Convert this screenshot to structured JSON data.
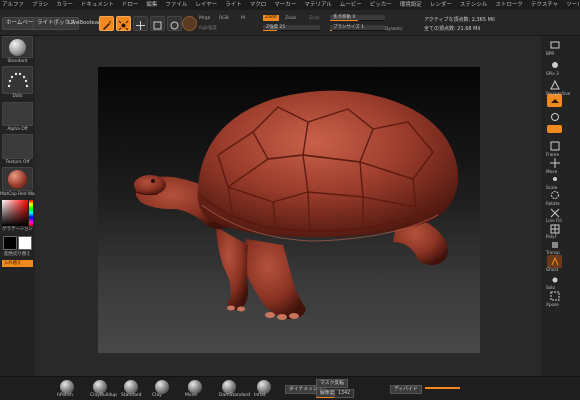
{
  "menu": [
    "アルファ",
    "ブラシ",
    "カラー",
    "ドキュメント",
    "ドロー",
    "編集",
    "ファイル",
    "レイヤー",
    "ライト",
    "マクロ",
    "マーカー",
    "マテリアル",
    "ムービー",
    "ピッカー",
    "環境設定",
    "レンダー",
    "ステンシル",
    "ストローク",
    "テクスチャ",
    "ツール",
    "トランスフォーム",
    "Zプラグイン",
    "Zスクリプト"
  ],
  "toolbar": {
    "home_page": "ホームページ",
    "lightbox": "ライトボックス",
    "live_boolean": "LiveBoolean",
    "mrgb": "Mrgb",
    "rgb": "RGB",
    "m": "M",
    "rgb_intensity": "Rgb強度",
    "zadd": "Zadd",
    "zsub": "Zsub",
    "zcut": "Zcut",
    "z_intensity_label": "Z強度",
    "z_intensity_value": "25",
    "focal_shift_label": "焦点移動",
    "focal_shift_value": "0",
    "draw_size_label": "ブラシサイズ",
    "draw_size_value": "1",
    "dynamic": "Dynamic",
    "active_points": "アクティブな頂点数: 2,365 Mil",
    "total_points": "全ての頂点数: 21.68 Mil"
  },
  "left_panel": {
    "brush": "Standard",
    "stroke": "Dots",
    "alpha": "Alpha Off",
    "texture": "Texture Off",
    "material": "MatCap Red Wax",
    "gradient": "グラデーション",
    "switch_color": "配色切り替え",
    "swap": "入れ替え"
  },
  "right_panel": {
    "labels": [
      "BPR",
      "SPix 3",
      "",
      "Perspective",
      "",
      "Floor",
      "",
      "Local",
      "",
      "",
      "",
      "Frame",
      "Move",
      "Scale",
      "Rotate",
      "Line Fill",
      "PolyF",
      "Transp",
      "",
      "Ghost",
      "",
      "Solo",
      "",
      "Xpose"
    ]
  },
  "bottom": {
    "brushes": [
      "hPolish",
      "ClayBuildup",
      "Standard",
      "Clay",
      "Move",
      "DamStandard",
      "Inflat"
    ],
    "dynamesh": "ダイナメッシュ",
    "mask_by_cavity": "マスク反転",
    "resolution_label": "解像度",
    "resolution_value": "1342",
    "divide": "ディバイド",
    "smooth": "ZRemesher"
  },
  "colors": {
    "accent": "#f08a1e",
    "clay": "#9b3c2c",
    "background": "#2b2b2b"
  }
}
